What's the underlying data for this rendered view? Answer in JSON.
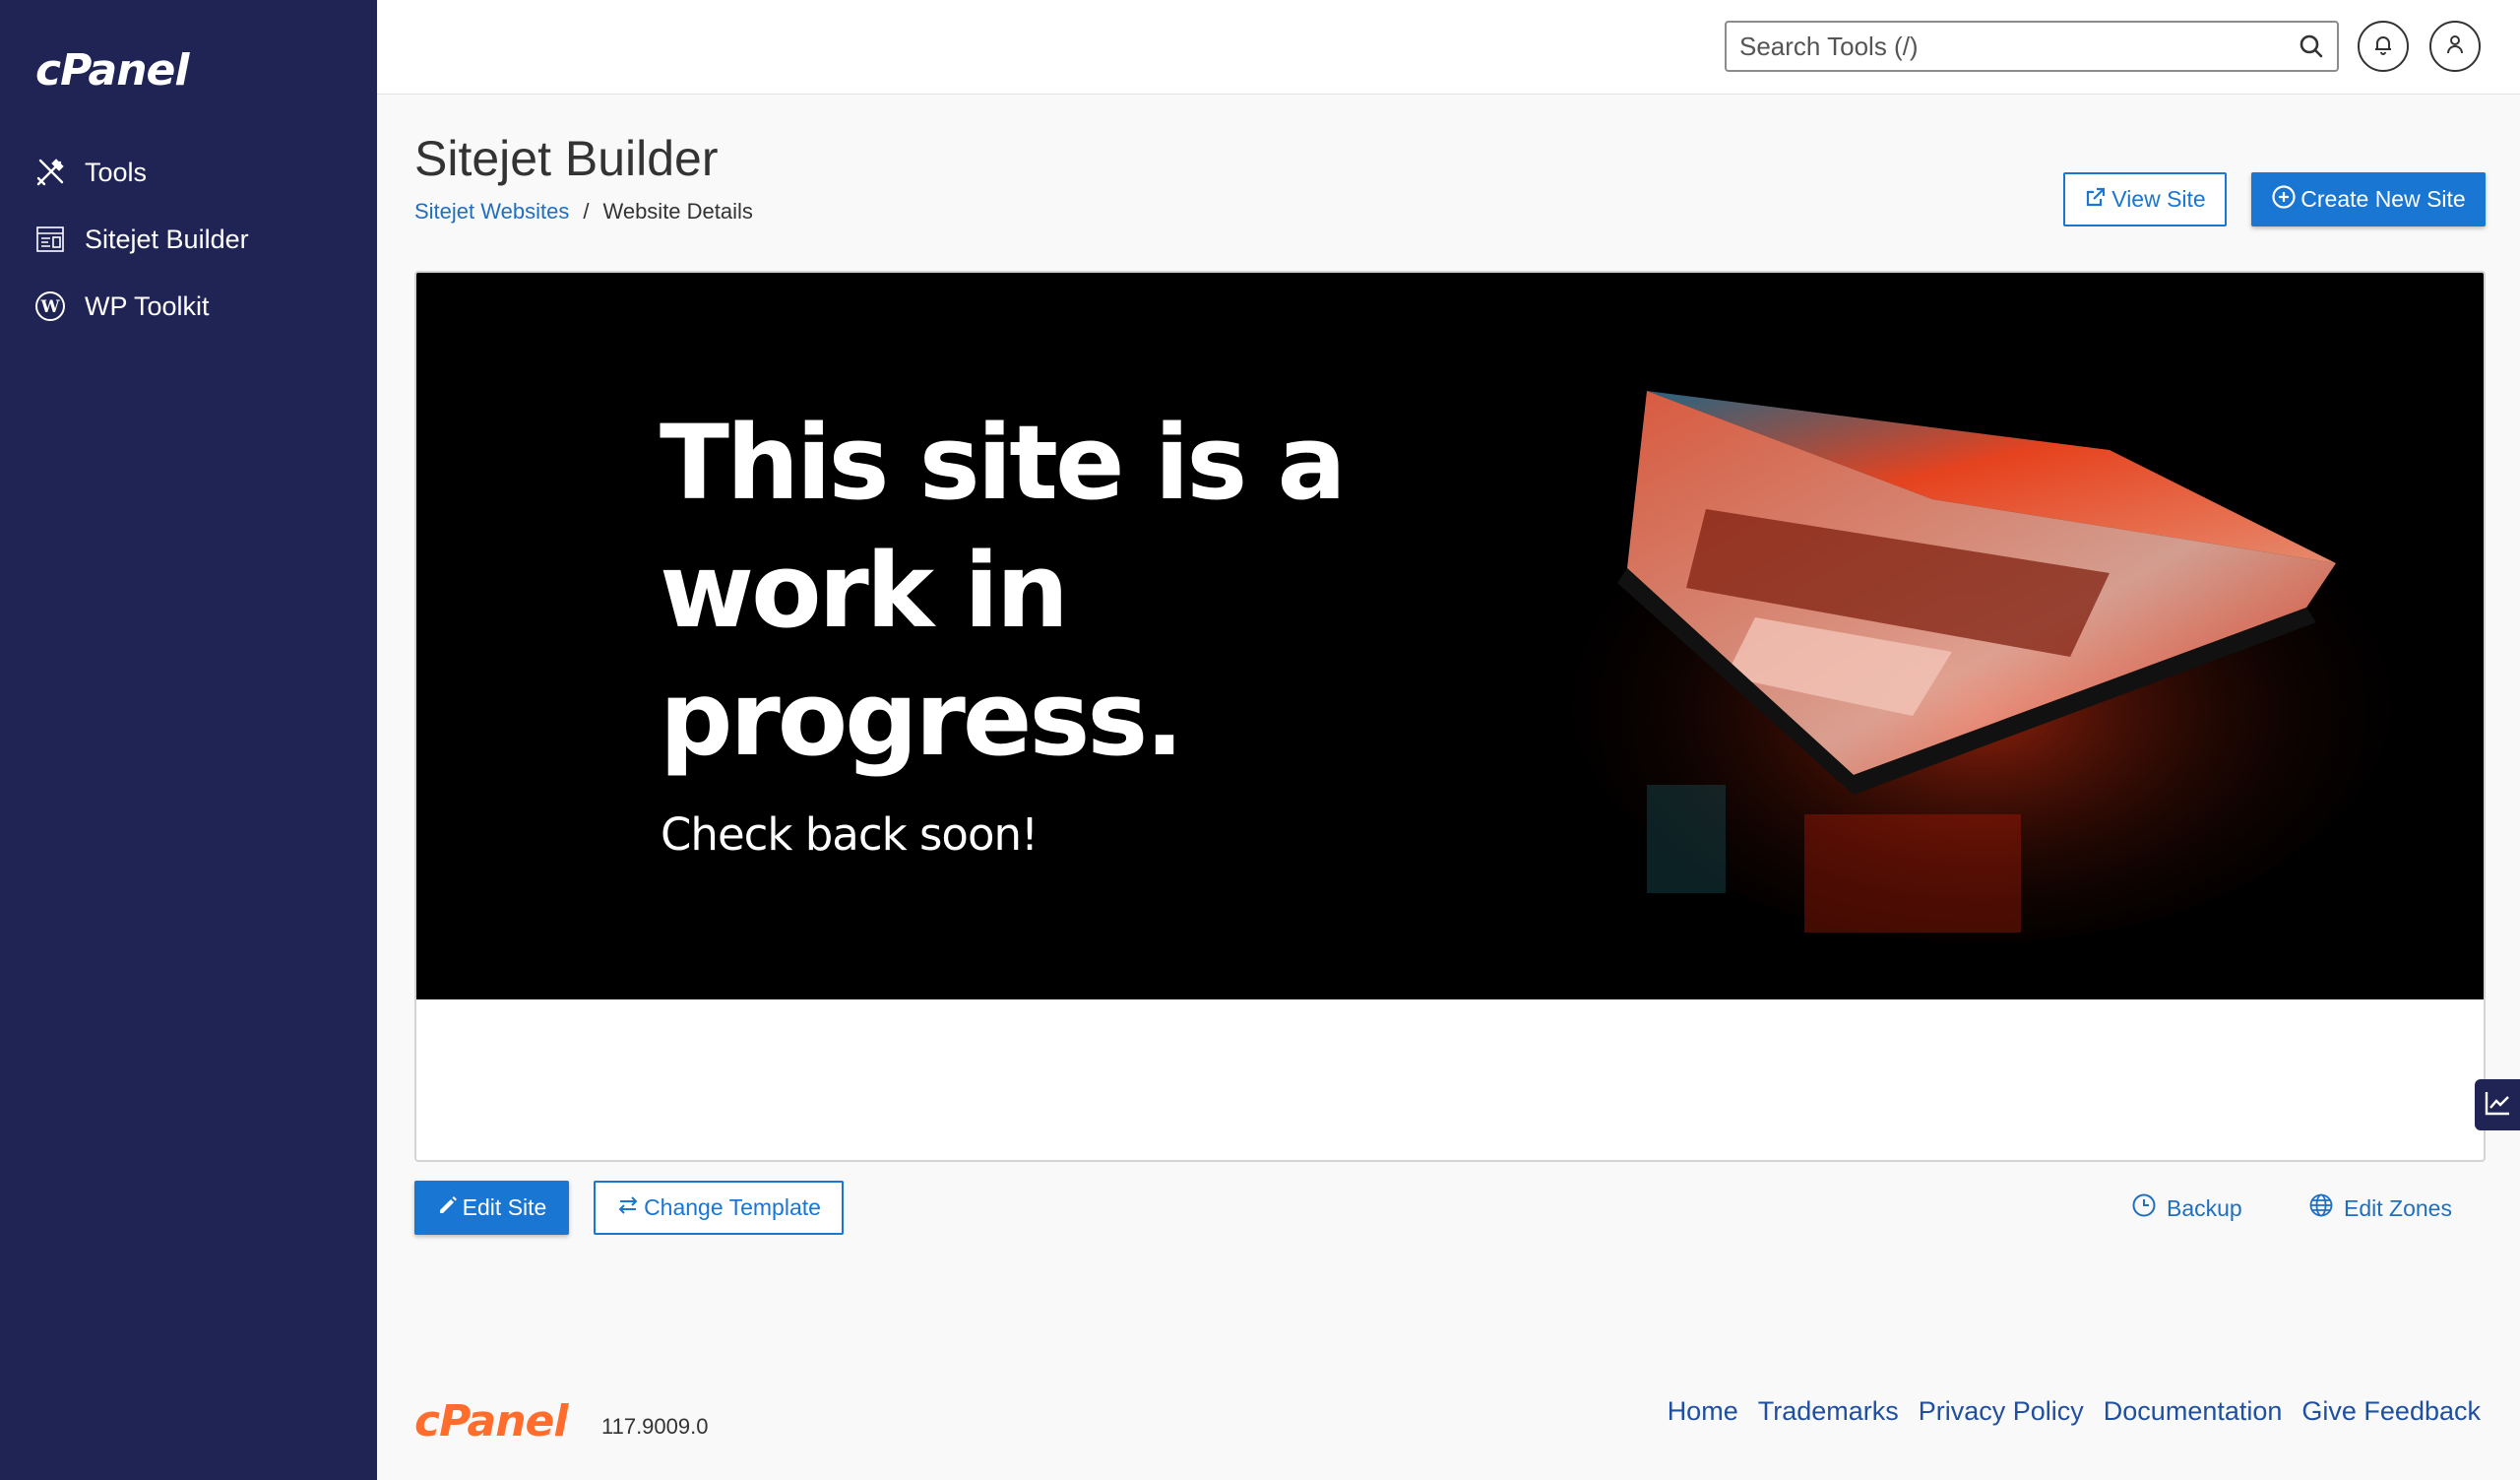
{
  "sidebar": {
    "logo": "cPanel",
    "items": [
      {
        "label": "Tools",
        "icon": "tools-icon"
      },
      {
        "label": "Sitejet Builder",
        "icon": "sitejet-icon"
      },
      {
        "label": "WP Toolkit",
        "icon": "wordpress-icon"
      }
    ]
  },
  "header": {
    "search_placeholder": "Search Tools (/)",
    "icons": [
      "search-icon",
      "bell-icon",
      "user-icon"
    ]
  },
  "page": {
    "title": "Sitejet Builder",
    "breadcrumb": {
      "link": "Sitejet Websites",
      "separator": "/",
      "current": "Website Details"
    },
    "view_site_label": "View Site",
    "create_site_label": "Create New Site"
  },
  "preview": {
    "headline": "This site is a work in progress.",
    "subline": "Check back soon!"
  },
  "actions": {
    "edit_site": "Edit Site",
    "change_template": "Change Template",
    "backup": "Backup",
    "edit_zones": "Edit Zones"
  },
  "footer": {
    "logo": "cPanel",
    "version": "117.9009.0",
    "links": [
      "Home",
      "Trademarks",
      "Privacy Policy",
      "Documentation",
      "Give Feedback"
    ]
  },
  "colors": {
    "sidebar": "#202454",
    "accent": "#1976d2",
    "footer_logo": "#ff6c2c"
  }
}
